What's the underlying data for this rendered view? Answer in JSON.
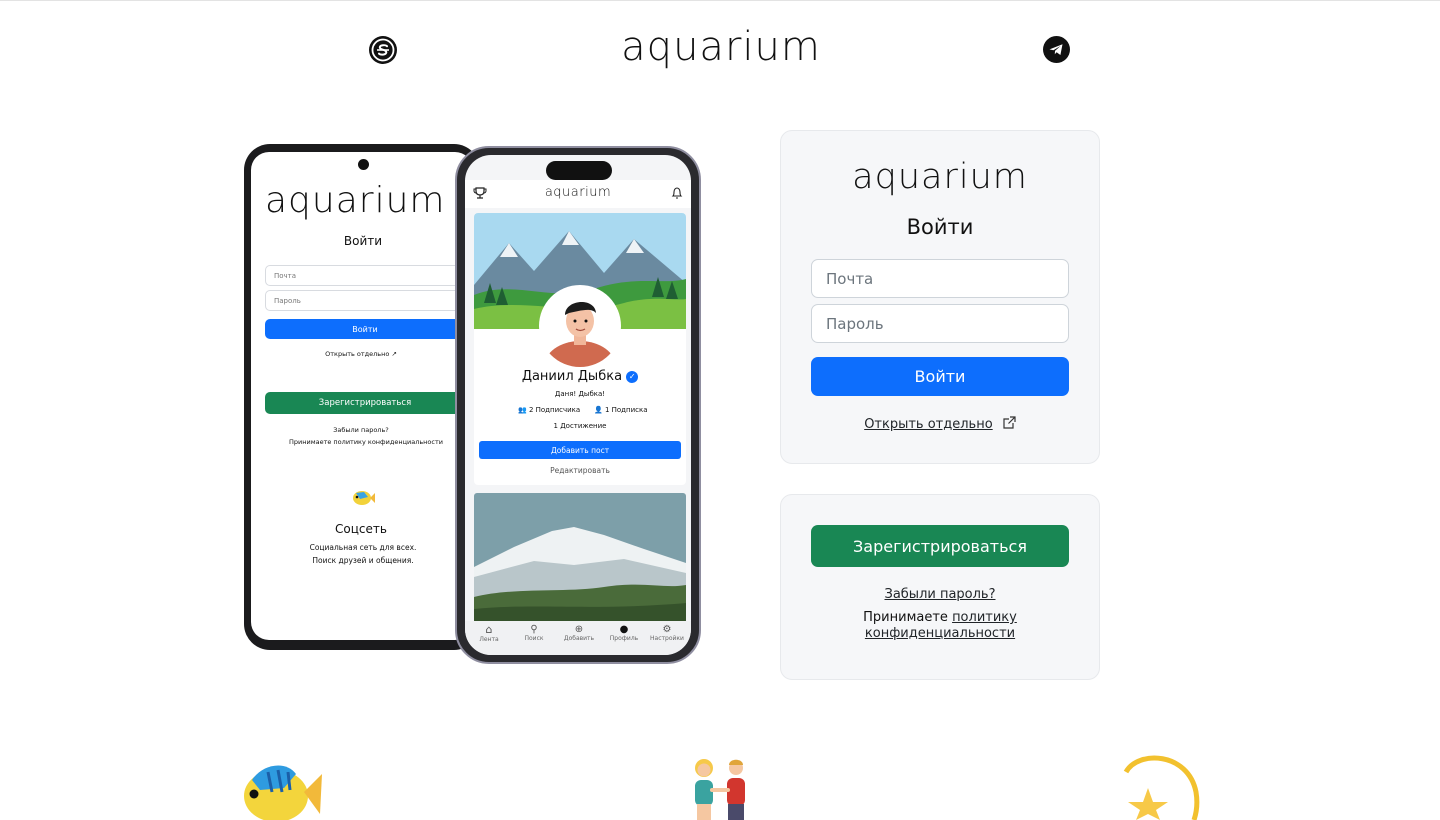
{
  "header": {
    "brand": "aquarium",
    "left_icon": "currency-s-icon",
    "right_icon": "telegram-icon"
  },
  "phone_left": {
    "brand": "aquarium",
    "title": "Войти",
    "email_placeholder": "Почта",
    "password_placeholder": "Пароль",
    "login_label": "Войти",
    "open_separately": "Открыть отдельно",
    "register_label": "Зарегистрироваться",
    "forgot": "Забыли пароль?",
    "policy": "Принимаете политику конфиденциальности",
    "feature_title": "Соцсеть",
    "feature_line1": "Социальная сеть для всех.",
    "feature_line2": "Поиск друзей и общения."
  },
  "phone_right": {
    "brand": "aquarium",
    "name": "Даниил Дыбка",
    "status": "Даня! Дыбка!",
    "followers": "2 Подписчика",
    "following": "1 Подписка",
    "achievements": "1 Достижение",
    "add_post": "Добавить пост",
    "edit": "Редактировать",
    "tabs": [
      "Лента",
      "Поиск",
      "Добавить",
      "Профиль",
      "Настройки"
    ]
  },
  "login_card": {
    "brand": "aquarium",
    "title": "Войти",
    "email_placeholder": "Почта",
    "password_placeholder": "Пароль",
    "login_label": "Войти",
    "open_separately": "Открыть отдельно"
  },
  "register_card": {
    "register_label": "Зарегистрироваться",
    "forgot": "Забыли пароль?",
    "policy_prefix": "Принимаете",
    "policy_link_1": "политику",
    "policy_link_2": "конфиденциальности"
  },
  "colors": {
    "primary": "#0d6efd",
    "success": "#198754",
    "card_bg": "#f6f7f9"
  }
}
